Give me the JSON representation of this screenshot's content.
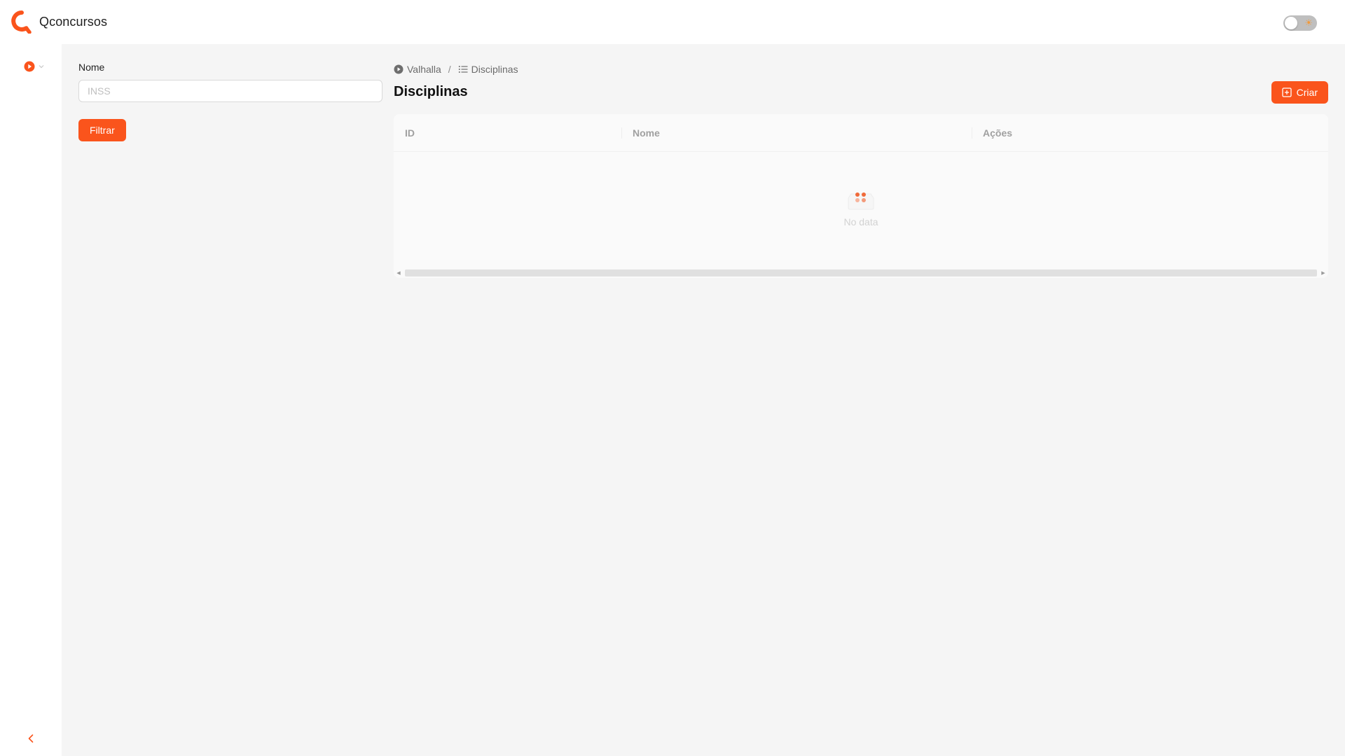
{
  "header": {
    "app_name": "Qconcursos",
    "logo_icon": "qconcursos-logo-icon",
    "theme_toggle": {
      "state": "off",
      "icon": "sun-icon"
    }
  },
  "colors": {
    "accent": "#fa541c",
    "sidebar_bg": "#ffffff",
    "page_bg": "#f5f5f5"
  },
  "sidebar": {
    "menu_icon": "play-circle-icon",
    "collapse_icon": "chevron-left-icon"
  },
  "filter": {
    "name_label": "Nome",
    "name_placeholder": "INSS",
    "name_value": "",
    "submit_label": "Filtrar"
  },
  "breadcrumb": {
    "items": [
      {
        "label": "Valhalla",
        "icon": "play-circle-icon"
      },
      {
        "label": "Disciplinas",
        "icon": "list-icon"
      }
    ],
    "separator": "/"
  },
  "page": {
    "title": "Disciplinas",
    "create_label": "Criar",
    "create_icon": "plus-square-icon"
  },
  "table": {
    "columns": [
      "ID",
      "Nome",
      "Ações"
    ],
    "rows": [],
    "empty_text": "No data",
    "empty_icon": "empty-inbox-icon"
  }
}
